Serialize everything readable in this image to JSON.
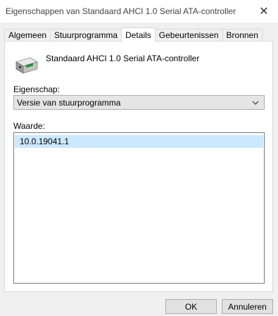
{
  "window": {
    "title": "Eigenschappen van Standaard AHCI 1.0 Serial ATA-controller",
    "close_glyph": "✕"
  },
  "tabs": [
    {
      "label": "Algemeen"
    },
    {
      "label": "Stuurprogramma"
    },
    {
      "label": "Details",
      "active": true
    },
    {
      "label": "Gebeurtenissen"
    },
    {
      "label": "Bronnen"
    }
  ],
  "device": {
    "name": "Standaard AHCI 1.0 Serial ATA-controller",
    "icon": "drive-controller-icon"
  },
  "property": {
    "label": "Eigenschap:",
    "selected": "Versie van stuurprogramma"
  },
  "value": {
    "label": "Waarde:",
    "items": [
      "10.0.19041.1"
    ]
  },
  "buttons": {
    "ok": "OK",
    "cancel": "Annuleren"
  },
  "colors": {
    "selection": "#cce8ff",
    "button_face": "#e1e1e1",
    "window_bg": "#f0f0f0"
  }
}
